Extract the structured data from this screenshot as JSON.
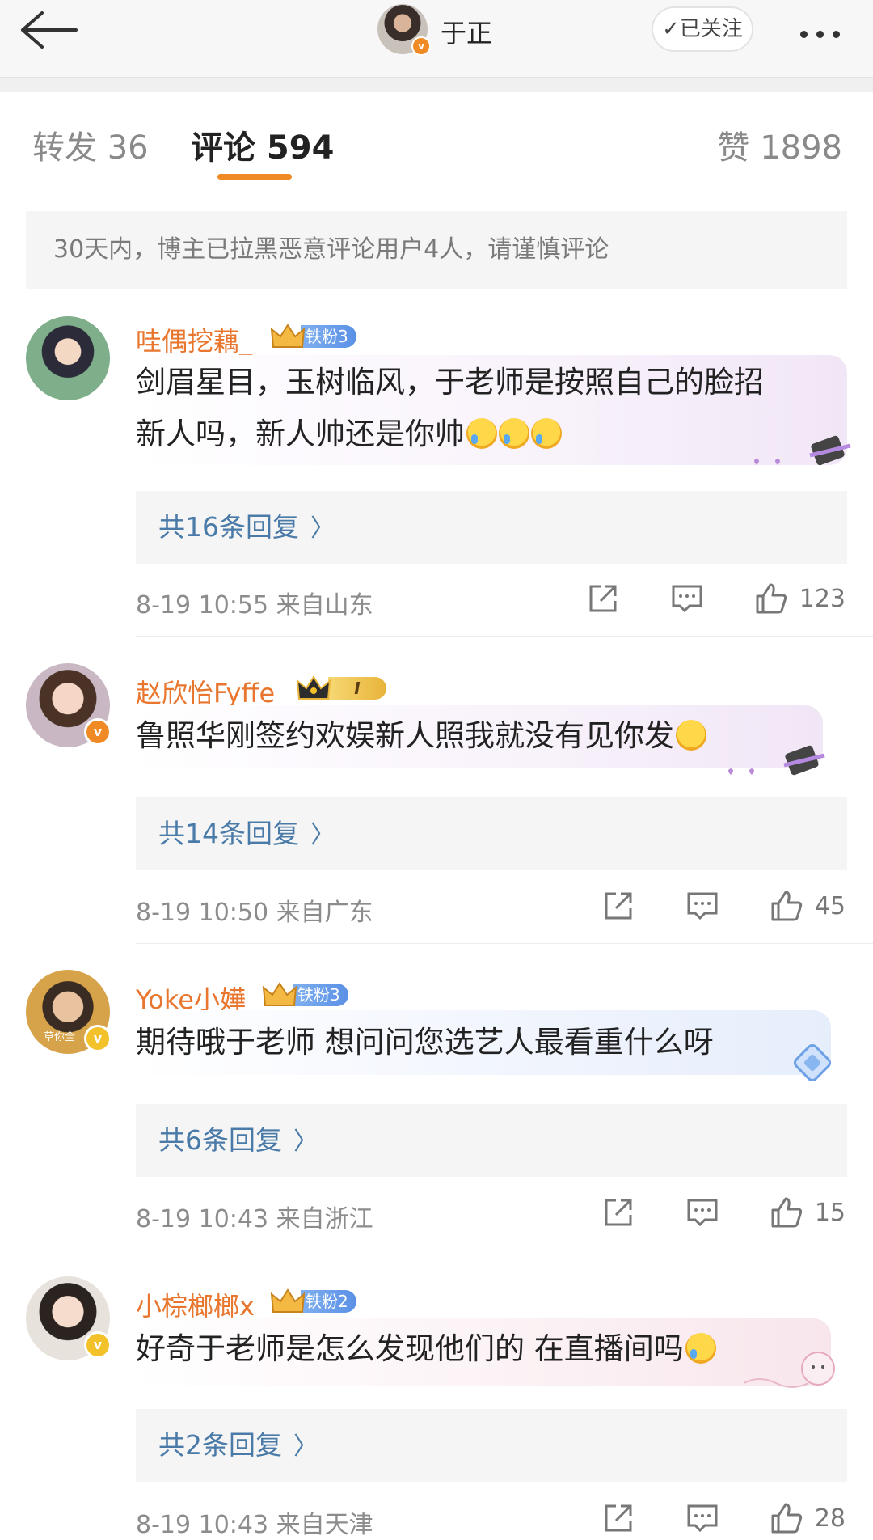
{
  "header": {
    "name": "于正",
    "follow_label": "已关注"
  },
  "tabs": [
    {
      "label": "转发 36"
    },
    {
      "label": "评论 594"
    },
    {
      "label": "赞 1898"
    }
  ],
  "notice": "30天内，博主已拉黑恶意评论用户4人，请谨慎评论",
  "comments": [
    {
      "user": "哇偶挖藕_",
      "fan_label": "铁粉3",
      "text_line1": "剑眉星目，玉树临风，于老师是按照自己的脸招",
      "text_line2": "新人吗，新人帅还是你帅",
      "replies": "共16条回复",
      "time": "8-19 10:55",
      "location": "来自山东",
      "likes": "123"
    },
    {
      "user": "赵欣怡Fyffe",
      "fan_label": "I",
      "text_line1": "鲁照华刚签约欢娱新人照我就没有见你发",
      "replies": "共14条回复",
      "time": "8-19 10:50",
      "location": "来自广东",
      "likes": "45"
    },
    {
      "user": "Yoke小嬅",
      "fan_label": "铁粉3",
      "avatar_text": "草你全",
      "text_line1": "期待哦于老师 想问问您选艺人最看重什么呀",
      "replies": "共6条回复",
      "time": "8-19 10:43",
      "location": "来自浙江",
      "likes": "15"
    },
    {
      "user": "小棕榔榔x",
      "fan_label": "铁粉2",
      "text_line1": "好奇于老师是怎么发现他们的 在直播间吗",
      "replies": "共2条回复",
      "time": "8-19 10:43",
      "location": "来自天津",
      "likes": "28"
    }
  ],
  "colors": {
    "accent": "#f08a24",
    "username": "#e8762e",
    "reply_link": "#4a7aa8"
  },
  "icons": [
    "back-arrow-icon",
    "more-icon",
    "share-icon",
    "comment-icon",
    "like-icon",
    "chevron-right-icon",
    "verified-icon",
    "crown-icon"
  ]
}
